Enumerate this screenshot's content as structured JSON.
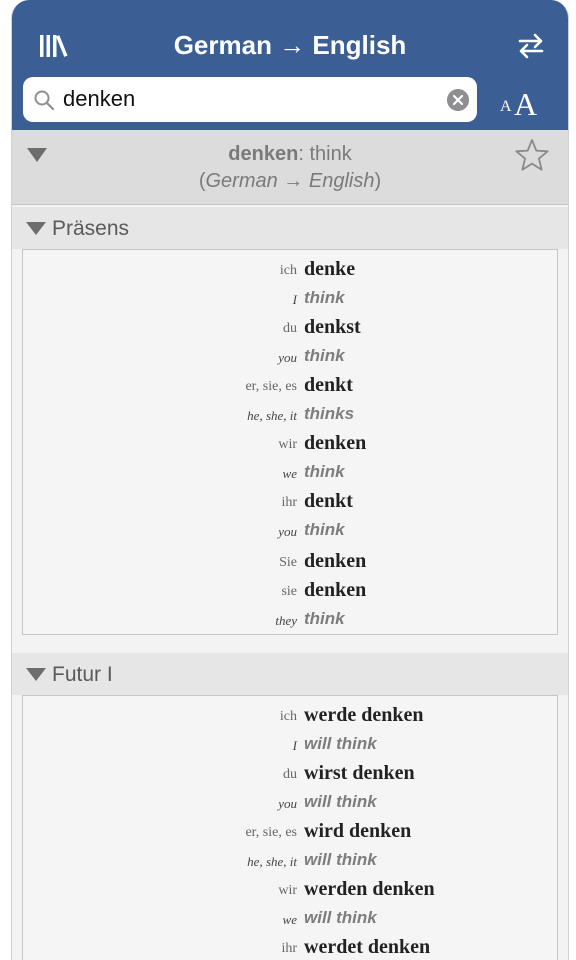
{
  "nav": {
    "title": "German → English",
    "left_icon": "library-icon",
    "right_icon": "swap-icon"
  },
  "search": {
    "value": "denken",
    "placeholder": ""
  },
  "font_size": {
    "small": "A",
    "big": "A"
  },
  "entry": {
    "headword": "denken",
    "separator": ": ",
    "translation": "think",
    "lang_open": "(",
    "lang_from": "German",
    "lang_arrow": " → ",
    "lang_to": "English",
    "lang_close": ")"
  },
  "sections": [
    {
      "title": "Präsens",
      "rows": [
        {
          "de_pron": "ich",
          "de_form": "denke",
          "en_pron": "I",
          "en_form": "think"
        },
        {
          "de_pron": "du",
          "de_form": "denkst",
          "en_pron": "you",
          "en_form": "think"
        },
        {
          "de_pron": "er, sie, es",
          "de_form": "denkt",
          "en_pron": "he, she, it",
          "en_form": "thinks"
        },
        {
          "de_pron": "wir",
          "de_form": "denken",
          "en_pron": "we",
          "en_form": "think"
        },
        {
          "de_pron": "ihr",
          "de_form": "denkt",
          "en_pron": "you",
          "en_form": "think"
        },
        {
          "de_pron": "Sie",
          "de_form": "denken"
        },
        {
          "de_pron": "sie",
          "de_form": "denken",
          "en_pron": "they",
          "en_form": "think"
        }
      ]
    },
    {
      "title": "Futur I",
      "rows": [
        {
          "de_pron": "ich",
          "de_form": "werde denken",
          "en_pron": "I",
          "en_form": "will think"
        },
        {
          "de_pron": "du",
          "de_form": "wirst denken",
          "en_pron": "you",
          "en_form": "will think"
        },
        {
          "de_pron": "er, sie, es",
          "de_form": "wird denken",
          "en_pron": "he, she, it",
          "en_form": "will think"
        },
        {
          "de_pron": "wir",
          "de_form": "werden denken",
          "en_pron": "we",
          "en_form": "will think"
        },
        {
          "de_pron": "ihr",
          "de_form": "werdet denken"
        }
      ]
    }
  ],
  "colors": {
    "navbar": "#3b5f95",
    "header_bg": "#dcdcdc",
    "section_bg": "#e6e6e6"
  }
}
